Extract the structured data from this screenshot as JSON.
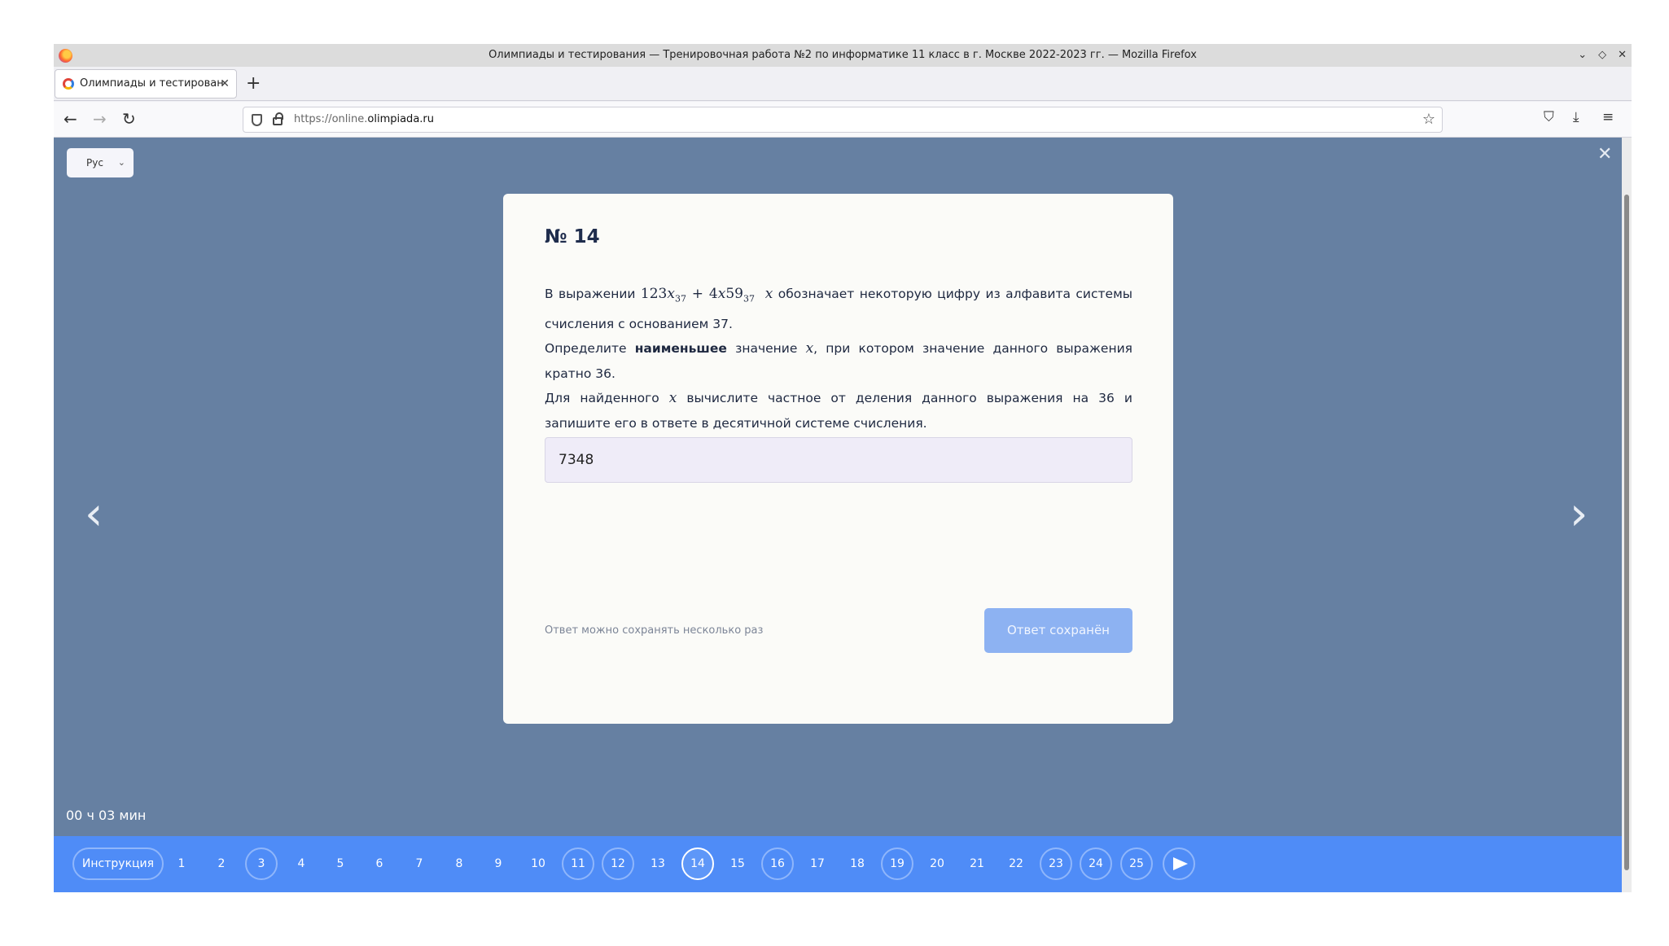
{
  "window": {
    "title": "Олимпиады и тестирования — Тренировочная работа №2 по информатике 11 класс в г. Москве 2022-2023 гг. — Mozilla Firefox",
    "controls": [
      "⌄",
      "◇",
      "✕"
    ]
  },
  "tab": {
    "label": "Олимпиады и тестирован",
    "close": "✕",
    "new_tab": "+"
  },
  "nav": {
    "back": "←",
    "forward": "→",
    "reload": "↻",
    "url_prefix": "https://online.",
    "url_domain": "olimpiada.ru",
    "star": "☆",
    "toolbar_icons": [
      "pocket-icon",
      "download-icon",
      "menu-icon"
    ]
  },
  "page": {
    "language": "Рус",
    "close": "✕",
    "prev_arrow": "‹",
    "next_arrow": "›",
    "question": {
      "number": "№ 14",
      "text_1": "В выражении",
      "expr_a": "123",
      "expr_x": "x",
      "expr_sub1": "37",
      "expr_plus": " + 4",
      "expr_b": "59",
      "expr_sub2": "37",
      "text_2": "обозначает некоторую цифру из алфавита системы счисления с основанием 37.",
      "line2_a": "Определите",
      "line2_bold": "наименьшее",
      "line2_b": "значение",
      "line2_c": ", при котором значение данного выражения кратно 36.",
      "line3_a": "Для найденного",
      "line3_b": "вычислите частное от деления данного выражения на 36 и запишите его в ответе в десятичной системе счисления."
    },
    "answer_value": "7348",
    "hint": "Ответ можно сохранять несколько раз",
    "save_label": "Ответ сохранён",
    "timer": "00 ч 03 мин"
  },
  "question_nav": {
    "instructions": "Инструкция",
    "current": "14",
    "answered": [
      "3",
      "11",
      "12",
      "16",
      "19",
      "23",
      "24",
      "25"
    ],
    "items": [
      "1",
      "2",
      "3",
      "4",
      "5",
      "6",
      "7",
      "8",
      "9",
      "10",
      "11",
      "12",
      "13",
      "14",
      "15",
      "16",
      "17",
      "18",
      "19",
      "20",
      "21",
      "22",
      "23",
      "24",
      "25"
    ]
  },
  "colors": {
    "page_bg": "#6680a2",
    "nav_bar": "#4f8cf7",
    "save_button": "#8db2f2",
    "card_bg": "#fbfbf8",
    "answer_bg": "#efecf8"
  }
}
